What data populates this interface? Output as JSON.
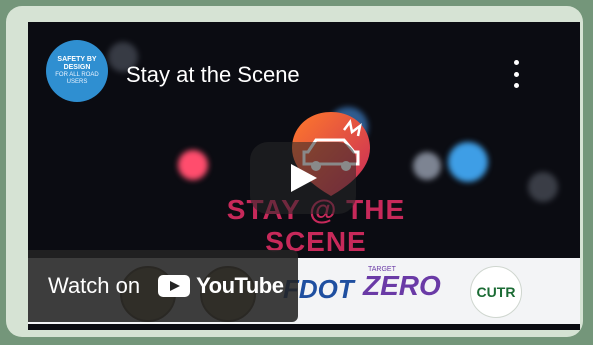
{
  "video": {
    "title": "Stay at the Scene",
    "watch_label": "Watch on",
    "youtube_label": "YouTube"
  },
  "channel": {
    "avatar_line1": "SAFETY BY DESIGN",
    "avatar_line2": "FOR ALL ROAD USERS"
  },
  "overlay": {
    "scene_text": "STAY @ THE SCENE"
  },
  "partners": {
    "fdot": "FDOT",
    "zero": "ZERO",
    "zero_prefix": "TARGET",
    "cutr": "CUTR"
  },
  "icons": {
    "menu": "kebab-menu-icon",
    "play": "play-icon",
    "youtube": "youtube-logo-icon"
  },
  "colors": {
    "page_bg": "#74967a",
    "card_bg": "#d6e3d4",
    "accent_red": "#c7295a",
    "youtube_red": "#ff0000"
  }
}
